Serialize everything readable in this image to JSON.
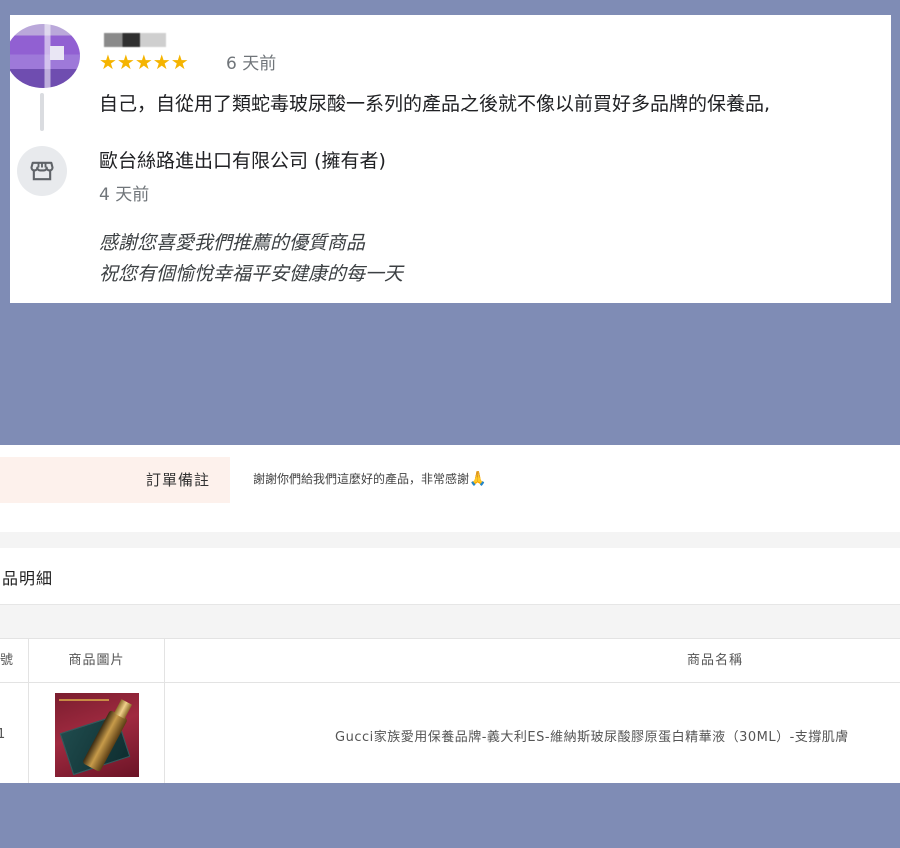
{
  "review": {
    "reviewer_name": "",
    "stars": "★★★★★",
    "time": "6 天前",
    "text": "自己，自從用了類蛇毒玻尿酸一系列的產品之後就不像以前買好多品牌的保養品,",
    "owner_name": "歐台絲路進出口有限公司 (擁有者)",
    "reply_time": "4 天前",
    "reply_line1": "感謝您喜愛我們推薦的優質商品",
    "reply_line2": "祝您有個愉悅幸福平安健康的每一天"
  },
  "order": {
    "note_label": "訂單備註",
    "note_text": "謝謝你們給我們這麼好的產品，非常感謝",
    "note_emoji": "🙏",
    "section_title": "品明細",
    "columns": [
      "號",
      "商品圖片",
      "商品名稱"
    ],
    "row": {
      "index": "1",
      "product_name": "Gucci家族愛用保養品牌-義大利ES-維納斯玻尿酸膠原蛋白精華液（30ML）-支撐肌膚"
    }
  },
  "colors": {
    "background": "#7f8cb5",
    "star": "#f5b400",
    "note_label_bg": "#fdf1ec"
  }
}
